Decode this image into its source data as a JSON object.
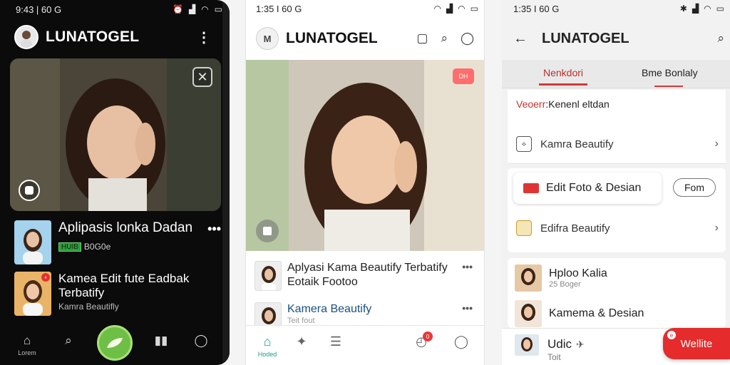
{
  "phone1": {
    "status_time": "9:43 | 60 G",
    "brand": "LUNATOGEL",
    "list": [
      {
        "title": "Aplipasis lonka Dadan",
        "badge": "HUIB",
        "meta": "B0G0e"
      },
      {
        "title": "Kamea Edit fute Eadbak Terbatify",
        "meta": "Kamra Beautifly"
      }
    ],
    "nav_labels": {
      "home": "Lorem"
    }
  },
  "phone2": {
    "status_time": "1:35 I 60 G",
    "brand": "LUNATOGEL",
    "logo_text": "M",
    "hero_tag": "DH",
    "list": [
      {
        "title": "Aplyasi Kama Beautify Terbatify Eotaik Footoo"
      },
      {
        "title": "Kamera Beautify",
        "meta": "Teit fout"
      }
    ],
    "nav_labels": {
      "home": "Hoded"
    },
    "notif_count": "0"
  },
  "phone3": {
    "status_time": "1:35 I 60 G",
    "brand": "LUNATOGEL",
    "tabs": [
      "Nenkdori",
      "Bme Bonlaly"
    ],
    "section_prefix": "Veoerr",
    "section_rest": ":Kenenl eltdan",
    "row1": "Kamra Beautify",
    "pill": "Edit Foto & Desian",
    "form_btn": "Fom",
    "row2": "Edifra Beautify",
    "items": [
      {
        "title": "Hploo Kalia",
        "meta": "25 Boger"
      },
      {
        "title": "Kamema & Desian"
      }
    ],
    "bottom_title": "Udic",
    "bottom_sub": "Toit",
    "cta": "Wellite",
    "cta_badge": "e"
  },
  "colors": {
    "accent_green": "#6ebf45",
    "accent_teal": "#1e9a8f",
    "accent_red": "#e52b2b"
  }
}
